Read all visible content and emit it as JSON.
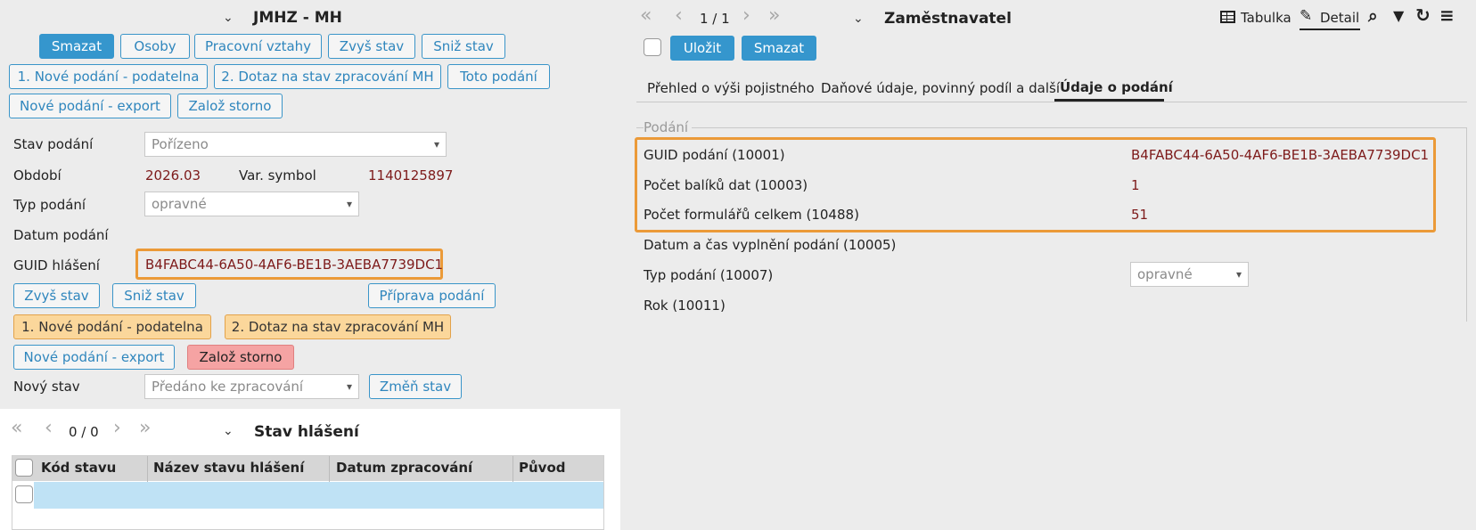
{
  "left": {
    "title": "JMHZ - MH",
    "buttons_top": {
      "delete": "Smazat",
      "persons": "Osoby",
      "work_relations": "Pracovní vztahy",
      "raise_state": "Zvyš stav",
      "lower_state": "Sniž stav",
      "new_submission_mailroom": "1. Nové podání - podatelna",
      "query_state": "2. Dotaz na stav zpracování MH",
      "this_submission": "Toto podání",
      "new_submission_export": "Nové podání - export",
      "create_cancel": "Založ storno"
    },
    "form": {
      "state_label": "Stav podání",
      "state_value": "Pořízeno",
      "period_label": "Období",
      "period_value": "2026.03",
      "varsymbol_label": "Var. symbol",
      "varsymbol_value": "1140125897",
      "type_label": "Typ podání",
      "type_value": "opravné",
      "date_label": "Datum podání",
      "guid_label": "GUID hlášení",
      "guid_value": "B4FABC44-6A50-4AF6-BE1B-3AEBA7739DC1"
    },
    "buttons_form": {
      "raise_state": "Zvyš stav",
      "lower_state": "Sniž stav",
      "prepare_submission": "Příprava podání",
      "new_submission_mailroom": "1. Nové podání - podatelna",
      "query_state": "2. Dotaz na stav zpracování MH",
      "new_submission_export": "Nové podání - export",
      "create_cancel": "Založ storno"
    },
    "new_state_label": "Nový stav",
    "new_state_value": "Předáno ke zpracování",
    "change_state": "Změň stav"
  },
  "report_state": {
    "pager": "0 / 0",
    "title": "Stav hlášení",
    "columns": [
      "Kód stavu",
      "Název stavu hlášení",
      "Datum zpracování",
      "Původ"
    ]
  },
  "right": {
    "pager": "1 / 1",
    "title": "Zaměstnavatel",
    "view_table": "Tabulka",
    "view_detail": "Detail",
    "save": "Uložit",
    "delete": "Smazat",
    "tabs": [
      "Přehled o výši pojistného",
      "Daňové údaje, povinný podíl a další",
      "Údaje o podání"
    ],
    "section": "Podání",
    "fields": [
      {
        "label": "GUID podání (10001)",
        "value": "B4FABC44-6A50-4AF6-BE1B-3AEBA7739DC1"
      },
      {
        "label": "Počet balíků dat (10003)",
        "value": "1"
      },
      {
        "label": "Počet formulářů celkem (10488)",
        "value": "51"
      },
      {
        "label": "Datum a čas vyplnění podání (10005)",
        "value": ""
      },
      {
        "label": "Typ podání (10007)",
        "value": "opravné"
      },
      {
        "label": "Rok (10011)",
        "value": ""
      }
    ]
  },
  "colors": {
    "accent": "#3596cd",
    "value_text": "#7d1a1a",
    "highlight": "#eb9a38",
    "orange_button": "#fbd79b",
    "red_button": "#f5a3a3"
  }
}
